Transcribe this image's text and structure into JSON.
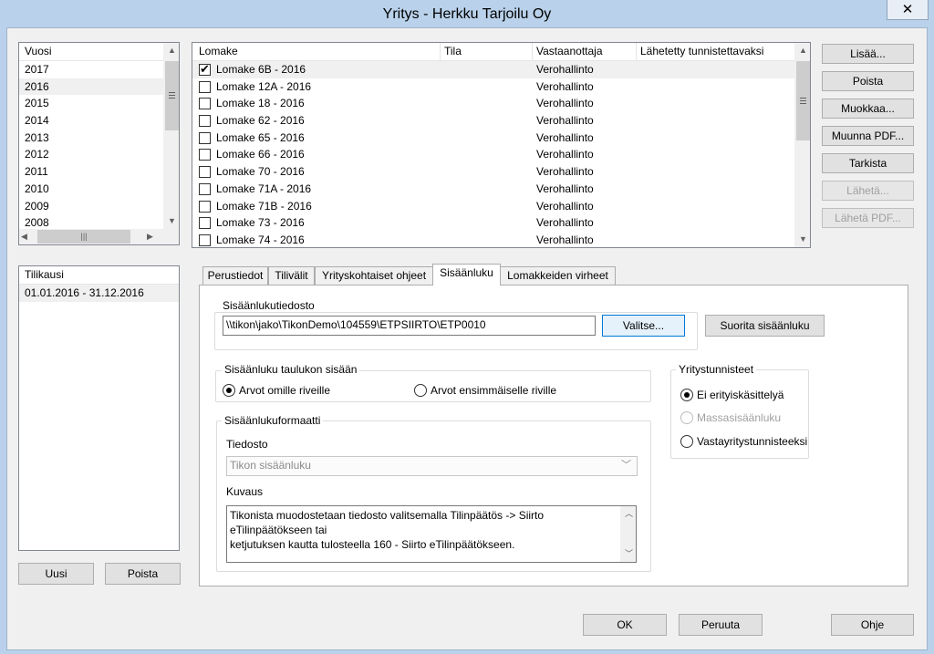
{
  "window": {
    "title": "Yritys - Herkku Tarjoilu Oy",
    "close_glyph": "✕"
  },
  "years": {
    "header": "Vuosi",
    "items": [
      "2017",
      "2016",
      "2015",
      "2014",
      "2013",
      "2012",
      "2011",
      "2010",
      "2009",
      "2008"
    ],
    "selected": "2016"
  },
  "forms": {
    "columns": [
      "Lomake",
      "Tila",
      "Vastaanottaja",
      "Lähetetty tunnistettavaksi"
    ],
    "rows": [
      {
        "name": "Lomake 6B - 2016",
        "status": "",
        "recipient": "Verohallinto",
        "sent": "",
        "checked": true
      },
      {
        "name": "Lomake 12A - 2016",
        "status": "",
        "recipient": "Verohallinto",
        "sent": "",
        "checked": false
      },
      {
        "name": "Lomake 18 - 2016",
        "status": "",
        "recipient": "Verohallinto",
        "sent": "",
        "checked": false
      },
      {
        "name": "Lomake 62 - 2016",
        "status": "",
        "recipient": "Verohallinto",
        "sent": "",
        "checked": false
      },
      {
        "name": "Lomake 65 - 2016",
        "status": "",
        "recipient": "Verohallinto",
        "sent": "",
        "checked": false
      },
      {
        "name": "Lomake 66 - 2016",
        "status": "",
        "recipient": "Verohallinto",
        "sent": "",
        "checked": false
      },
      {
        "name": "Lomake 70 - 2016",
        "status": "",
        "recipient": "Verohallinto",
        "sent": "",
        "checked": false
      },
      {
        "name": "Lomake 71A - 2016",
        "status": "",
        "recipient": "Verohallinto",
        "sent": "",
        "checked": false
      },
      {
        "name": "Lomake 71B - 2016",
        "status": "",
        "recipient": "Verohallinto",
        "sent": "",
        "checked": false
      },
      {
        "name": "Lomake 73 - 2016",
        "status": "",
        "recipient": "Verohallinto",
        "sent": "",
        "checked": false
      },
      {
        "name": "Lomake 74 - 2016",
        "status": "",
        "recipient": "Verohallinto",
        "sent": "",
        "checked": false
      }
    ]
  },
  "side_buttons": {
    "add": "Lisää...",
    "remove": "Poista",
    "edit": "Muokkaa...",
    "convert_pdf": "Muunna PDF...",
    "check": "Tarkista",
    "send": "Lähetä...",
    "send_pdf": "Lähetä PDF..."
  },
  "periods": {
    "header": "Tilikausi",
    "items": [
      "01.01.2016 - 31.12.2016"
    ],
    "new_button": "Uusi",
    "remove_button": "Poista"
  },
  "tabs": [
    "Perustiedot",
    "Tilivälit",
    "Yrityskohtaiset ohjeet",
    "Sisäänluku",
    "Lomakkeiden virheet"
  ],
  "active_tab": "Sisäänluku",
  "import_file": {
    "group_title": "Sisäänlukutiedosto",
    "path": "\\\\tikon\\jako\\TikonDemo\\104559\\ETPSIIRTO\\ETP0010",
    "choose_button": "Valitse...",
    "run_button": "Suorita sisäänluku"
  },
  "table_import": {
    "group_title": "Sisäänluku taulukon sisään",
    "option_own_rows": "Arvot omille riveille",
    "option_first_row": "Arvot ensimmäiselle riville"
  },
  "format": {
    "group_title": "Sisäänlukuformaatti",
    "file_label": "Tiedosto",
    "file_value": "Tikon sisäänluku",
    "description_label": "Kuvaus",
    "description_lines": [
      "Tikonista muodostetaan tiedosto valitsemalla Tilinpäätös -> Siirto",
      "eTilinpäätökseen tai",
      "ketjutuksen kautta tulosteella 160 - Siirto eTilinpäätökseen."
    ]
  },
  "company_ids": {
    "group_title": "Yritystunnisteet",
    "option_none": "Ei erityiskäsittelyä",
    "option_mass": "Massasisäänluku",
    "option_counter": "Vastayritystunnisteeksi"
  },
  "footer": {
    "ok": "OK",
    "cancel": "Peruuta",
    "help": "Ohje"
  }
}
